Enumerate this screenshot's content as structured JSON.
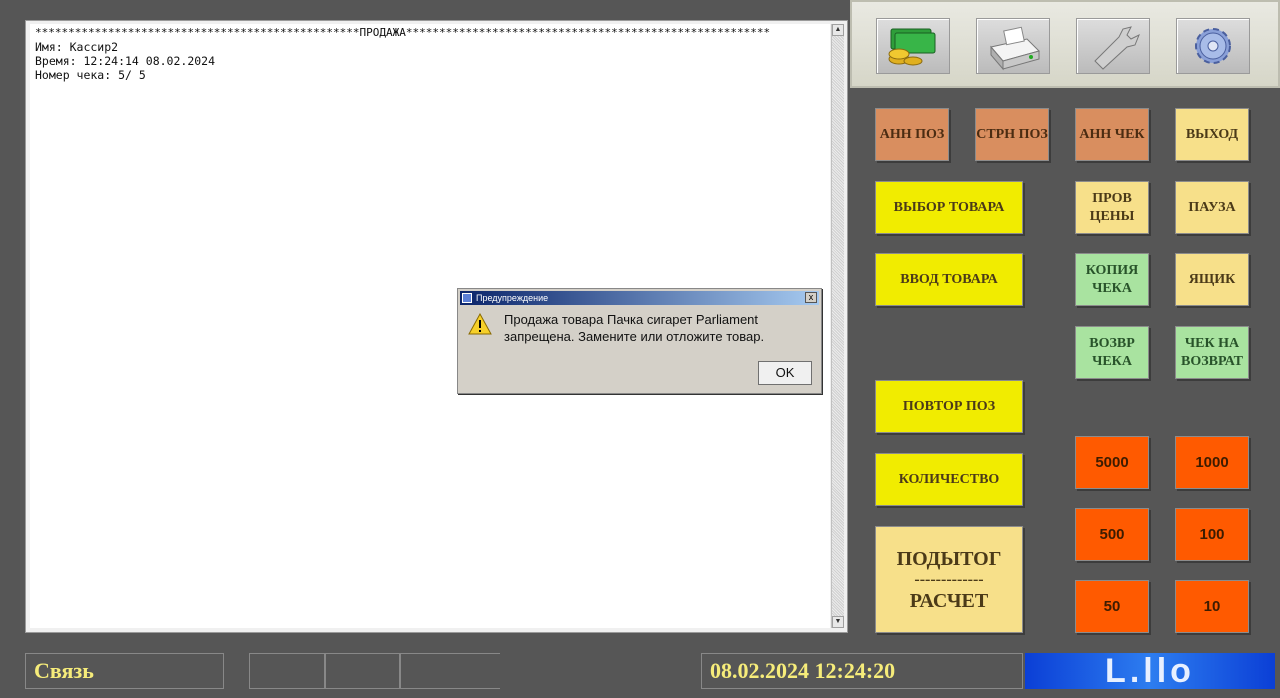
{
  "receipt": {
    "header": "*************************************************ПРОДАЖА*******************************************************",
    "lines": "Имя: Кассир2\nВремя: 12:24:14 08.02.2024\nНомер чека: 5/ 5"
  },
  "toolbar": {
    "icons": [
      "money-icon",
      "printer-icon",
      "wrench-icon",
      "gear-icon"
    ]
  },
  "buttons": {
    "ann_poz": "АНН ПОЗ",
    "strn_poz": "СТРН ПОЗ",
    "ann_chek": "АНН ЧЕК",
    "vyhod": "ВЫХОД",
    "vybor_tovara": "ВЫБОР ТОВАРА",
    "prov_ceny": "ПРОВ ЦЕНЫ",
    "pauza": "ПАУЗА",
    "vvod_tovara": "ВВОД ТОВАРА",
    "kopiya_cheka": "КОПИЯ ЧЕКА",
    "yaschik": "ЯЩИК",
    "vozvr_cheka": "ВОЗВР ЧЕКА",
    "chek_na_vozvrat": "ЧЕК НА ВОЗВРАТ",
    "povtor_poz": "ПОВТОР ПОЗ",
    "kolichestvo": "КОЛИЧЕСТВО",
    "podytog": "ПОДЫТОГ",
    "podytog_sep": "-------------",
    "raschet": "РАСЧЕТ",
    "cash_5000": "5000",
    "cash_1000": "1000",
    "cash_500": "500",
    "cash_100": "100",
    "cash_50": "50",
    "cash_10": "10"
  },
  "dialog": {
    "title": "Предупреждение",
    "message_line1": "Продажа товара Пачка сигарет Parliament",
    "message_line2": "запрещена. Замените или отложите товар.",
    "ok": "OK",
    "close": "x"
  },
  "status": {
    "connection": "Связь",
    "datetime": "08.02.2024 12:24:20",
    "logo": "L.llo"
  },
  "colors": {
    "background": "#565656",
    "orange": "#d98e5f",
    "beige": "#f7e08a",
    "yellow": "#f1ec00",
    "green": "#a9e3a0",
    "cash": "#ff5a00",
    "status_text": "#f6ec7a"
  }
}
